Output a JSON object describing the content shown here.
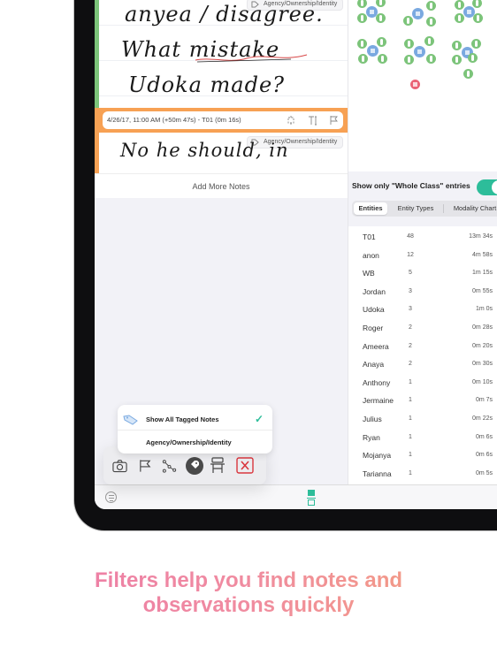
{
  "notes": {
    "note1": {
      "tag": "Agency/Ownership/Identity",
      "handwriting": [
        "anyea / disagree.",
        "What mistake",
        "Udoka made?"
      ],
      "accent_color": "#7cc47a"
    },
    "note2": {
      "meta": "4/26/17, 11:00 AM (+50m 47s) - T01 (0m 16s)",
      "tag": "Agency/Ownership/Identity",
      "handwriting": "No he should, in",
      "accent_color": "#f7a154"
    },
    "add_more_label": "Add More Notes"
  },
  "right_panel": {
    "toggle_label": "Show only \"Whole Class\" entries",
    "toggle_on": true,
    "toggle_color": "#2dbd9a",
    "tabs": [
      {
        "label": "Entities",
        "active": true
      },
      {
        "label": "Entity Types",
        "active": false
      },
      {
        "label": "Modality Chart",
        "active": false
      }
    ],
    "entities": [
      {
        "name": "T01",
        "count": "48",
        "time": "13m 34s"
      },
      {
        "name": "anon",
        "count": "12",
        "time": "4m 58s"
      },
      {
        "name": "WB",
        "count": "5",
        "time": "1m 15s"
      },
      {
        "name": "Jordan",
        "count": "3",
        "time": "0m 55s"
      },
      {
        "name": "Udoka",
        "count": "3",
        "time": "1m 0s"
      },
      {
        "name": "Roger",
        "count": "2",
        "time": "0m 28s"
      },
      {
        "name": "Ameera",
        "count": "2",
        "time": "0m 20s"
      },
      {
        "name": "Anaya",
        "count": "2",
        "time": "0m 30s"
      },
      {
        "name": "Anthony",
        "count": "1",
        "time": "0m 10s"
      },
      {
        "name": "Jermaine",
        "count": "1",
        "time": "0m 7s"
      },
      {
        "name": "Julius",
        "count": "1",
        "time": "0m 22s"
      },
      {
        "name": "Ryan",
        "count": "1",
        "time": "0m 6s"
      },
      {
        "name": "Mojanya",
        "count": "1",
        "time": "0m 6s"
      },
      {
        "name": "Tarianna",
        "count": "1",
        "time": "0m 5s"
      }
    ]
  },
  "filter_menu": {
    "items": [
      {
        "label": "Show All Tagged Notes",
        "checked": true
      },
      {
        "label": "Agency/Ownership/Identity",
        "checked": false
      }
    ],
    "check_glyph": "✓"
  },
  "toolbar": {
    "icons": [
      "camera-icon",
      "flag-icon",
      "network-icon",
      "tag-icon",
      "desk-icon",
      "close-icon"
    ]
  },
  "caption": {
    "line1": "Filters help you find notes and",
    "line2": "observations quickly"
  }
}
